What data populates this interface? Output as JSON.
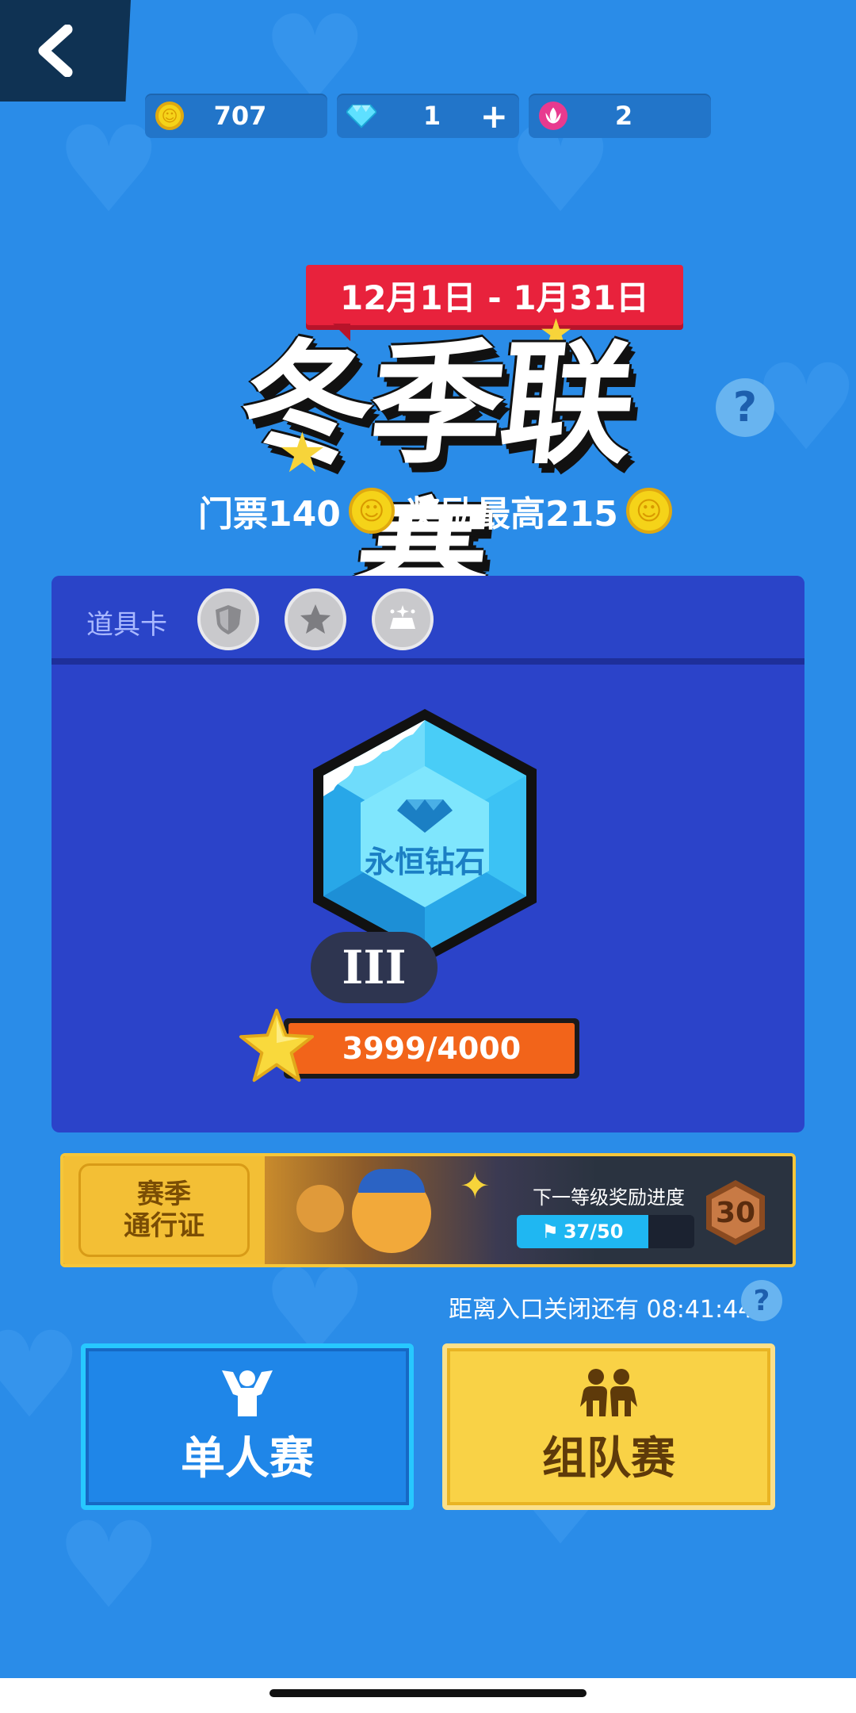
{
  "currency": {
    "coins": "707",
    "diamonds": "1",
    "flowers": "2",
    "add_symbol": "+"
  },
  "event": {
    "date_range": "12月1日 - 1月31日",
    "title": "冬季联赛",
    "ticket_text": "门票140",
    "reward_text": "奖励最高215"
  },
  "props": {
    "label": "道具卡",
    "items": [
      "shield-icon",
      "star-icon",
      "crown-sparkle-icon"
    ]
  },
  "rank": {
    "name": "永恒钻石",
    "tier": "III",
    "progress_text": "3999/4000",
    "progress_fraction": 0.99975
  },
  "season_pass": {
    "ticket_line1": "赛季",
    "ticket_line2": "通行证",
    "next_reward_label": "下一等级奖励进度",
    "progress_text": "37/50",
    "progress_fraction": 0.74,
    "level": "30"
  },
  "countdown": {
    "text": "距离入口关闭还有 08:41:44"
  },
  "modes": {
    "solo_label": "单人赛",
    "team_label": "组队赛"
  },
  "help_symbol": "?",
  "colors": {
    "background": "#2a8ce8",
    "ribbon": "#e8223c",
    "panel": "#2b43c9",
    "progress": "#f2641a",
    "team_button": "#f9d246"
  }
}
